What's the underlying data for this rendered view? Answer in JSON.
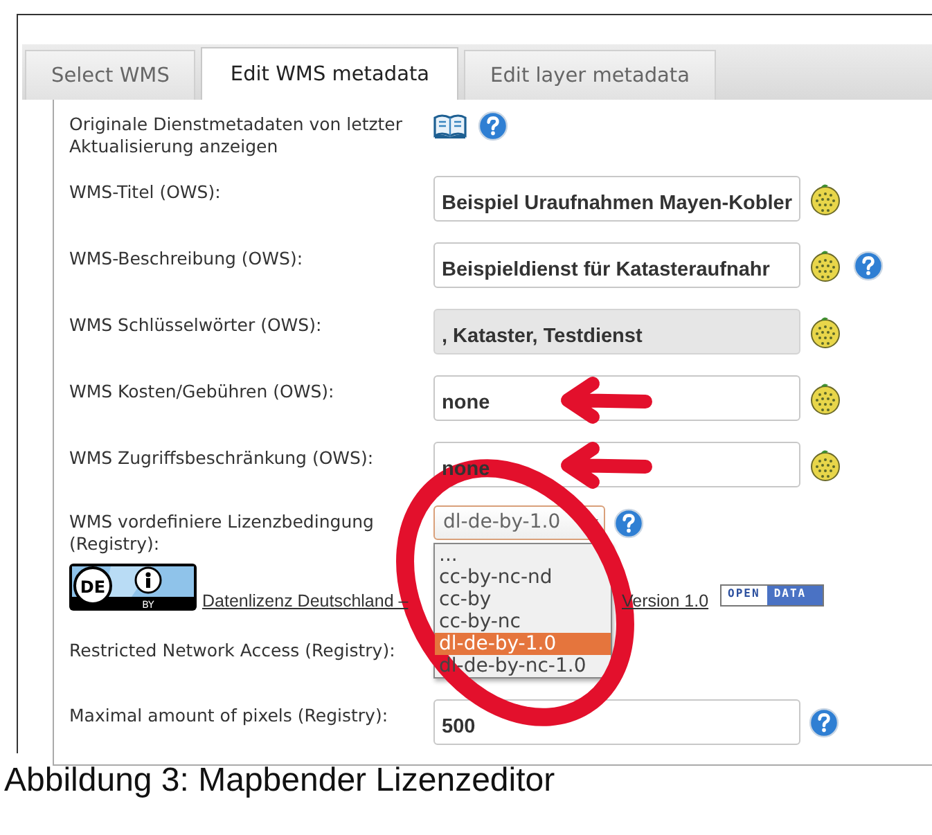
{
  "tabs": [
    {
      "label": "Select WMS",
      "selected": false
    },
    {
      "label": "Edit WMS metadata",
      "selected": true
    },
    {
      "label": "Edit layer metadata",
      "selected": false
    }
  ],
  "rows": [
    {
      "kind": "info",
      "label": "Originale Dienstmetadaten von letzter Aktualisierung anzeigen"
    },
    {
      "kind": "text",
      "label": "WMS-Titel (OWS):",
      "value": "Beispiel Uraufnahmen Mayen-Kobler",
      "disabled": false
    },
    {
      "kind": "text",
      "label": "WMS-Beschreibung (OWS):",
      "value": "Beispieldienst für Katasteraufnahr",
      "disabled": false
    },
    {
      "kind": "text",
      "label": "WMS Schlüsselwörter (OWS):",
      "value": ", Kataster, Testdienst",
      "disabled": true
    },
    {
      "kind": "text",
      "label": "WMS Kosten/Gebühren (OWS):",
      "value": "none",
      "disabled": false
    },
    {
      "kind": "text",
      "label": "WMS Zugriffsbeschränkung (OWS):",
      "value": "none",
      "disabled": false
    },
    {
      "kind": "select",
      "label": "WMS vordefiniere Lizenzbedingung (Registry):",
      "value": "dl-de-by-1.0",
      "expanded": true,
      "options": [
        {
          "label": "...",
          "selected": false
        },
        {
          "label": "cc-by-nc-nd",
          "selected": false
        },
        {
          "label": "cc-by",
          "selected": false
        },
        {
          "label": "cc-by-nc",
          "selected": false
        },
        {
          "label": "dl-de-by-1.0",
          "selected": true
        },
        {
          "label": "dl-de-by-nc-1.0",
          "selected": false
        }
      ]
    },
    {
      "kind": "license",
      "logo": {
        "country": "DE",
        "condition": "BY"
      },
      "link_start": "Datenlizenz Deutschland –",
      "link_end": "Version 1.0",
      "badge": [
        "OPEN",
        "DATA"
      ]
    },
    {
      "kind": "label",
      "label": "Restricted Network Access (Registry):"
    },
    {
      "kind": "text",
      "label": "Maximal amount of pixels (Registry):",
      "value": "500",
      "disabled": false
    }
  ],
  "annotations": [
    {
      "kind": "arrow"
    },
    {
      "kind": "arrow"
    },
    {
      "kind": "circle"
    }
  ],
  "caption": "Abbildung 3: Mapbender Lizenzeditor"
}
